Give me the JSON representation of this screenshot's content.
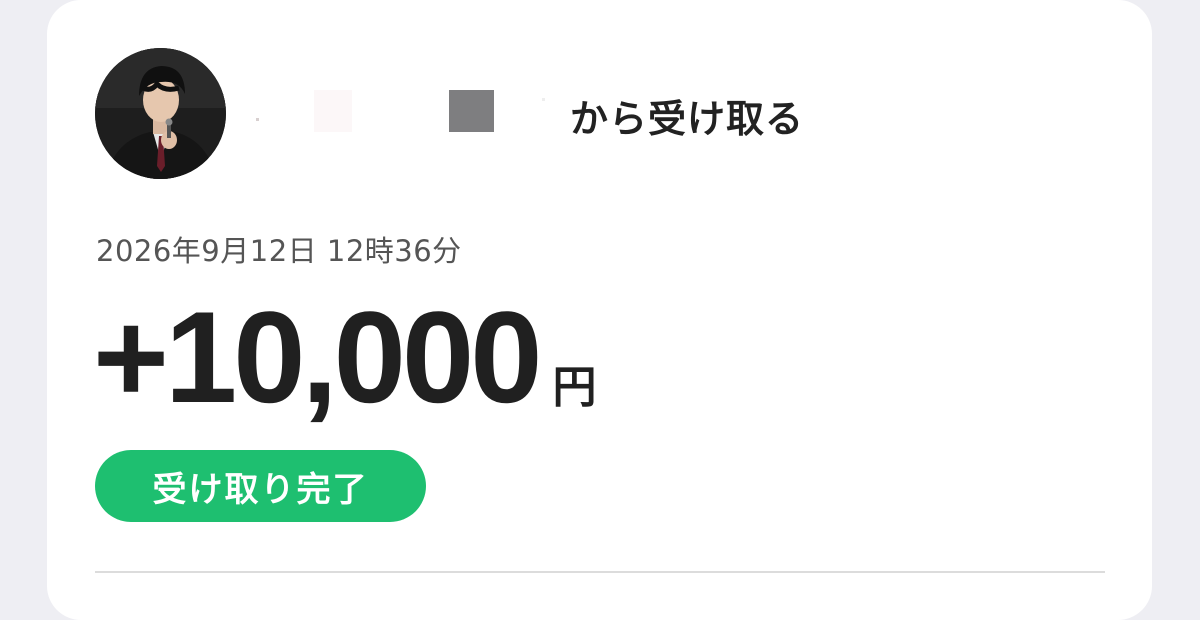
{
  "transaction": {
    "sender_suffix": "から受け取る",
    "datetime": "2026年9月12日 12時36分",
    "amount": "+10,000",
    "currency_unit": "円",
    "status": "受け取り完了"
  },
  "colors": {
    "status_badge": "#1ebf70",
    "card_background": "#ffffff",
    "page_background": "#eeeef3"
  }
}
